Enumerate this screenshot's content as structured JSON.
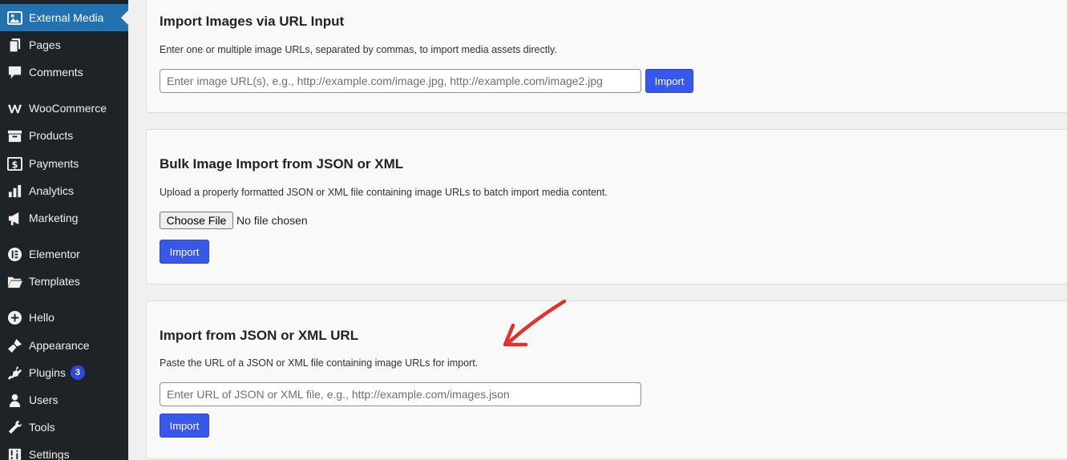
{
  "sidebar": {
    "items": [
      {
        "label": "External Media",
        "icon": "external-media-icon",
        "active": true
      },
      {
        "label": "Pages",
        "icon": "pages-icon"
      },
      {
        "label": "Comments",
        "icon": "comments-icon"
      },
      {
        "label": "WooCommerce",
        "icon": "woocommerce-icon"
      },
      {
        "label": "Products",
        "icon": "products-icon"
      },
      {
        "label": "Payments",
        "icon": "payments-icon"
      },
      {
        "label": "Analytics",
        "icon": "analytics-icon"
      },
      {
        "label": "Marketing",
        "icon": "marketing-icon"
      },
      {
        "label": "Elementor",
        "icon": "elementor-icon"
      },
      {
        "label": "Templates",
        "icon": "templates-icon"
      },
      {
        "label": "Hello",
        "icon": "plus-circle-icon"
      },
      {
        "label": "Appearance",
        "icon": "appearance-icon"
      },
      {
        "label": "Plugins",
        "icon": "plugins-icon",
        "badge": "3"
      },
      {
        "label": "Users",
        "icon": "users-icon"
      },
      {
        "label": "Tools",
        "icon": "tools-icon"
      },
      {
        "label": "Settings",
        "icon": "settings-icon"
      }
    ]
  },
  "url_import": {
    "title": "Import Images via URL Input",
    "description": "Enter one or multiple image URLs, separated by commas, to import media assets directly.",
    "placeholder": "Enter image URL(s), e.g., http://example.com/image.jpg, http://example.com/image2.jpg",
    "button": "Import"
  },
  "bulk_import": {
    "title": "Bulk Image Import from JSON or XML",
    "description": "Upload a properly formatted JSON or XML file containing image URLs to batch import media content.",
    "file_button": "Choose File",
    "file_status": "No file chosen",
    "button": "Import"
  },
  "json_url_import": {
    "title": "Import from JSON or XML URL",
    "description": "Paste the URL of a JSON or XML file containing image URLs for import.",
    "placeholder": "Enter URL of JSON or XML file, e.g., http://example.com/images.json",
    "button": "Import"
  },
  "colors": {
    "sidebar_bg": "#1d2327",
    "active_bg": "#2271b1",
    "button_bg": "#3858e9",
    "arrow": "#e0332b"
  }
}
